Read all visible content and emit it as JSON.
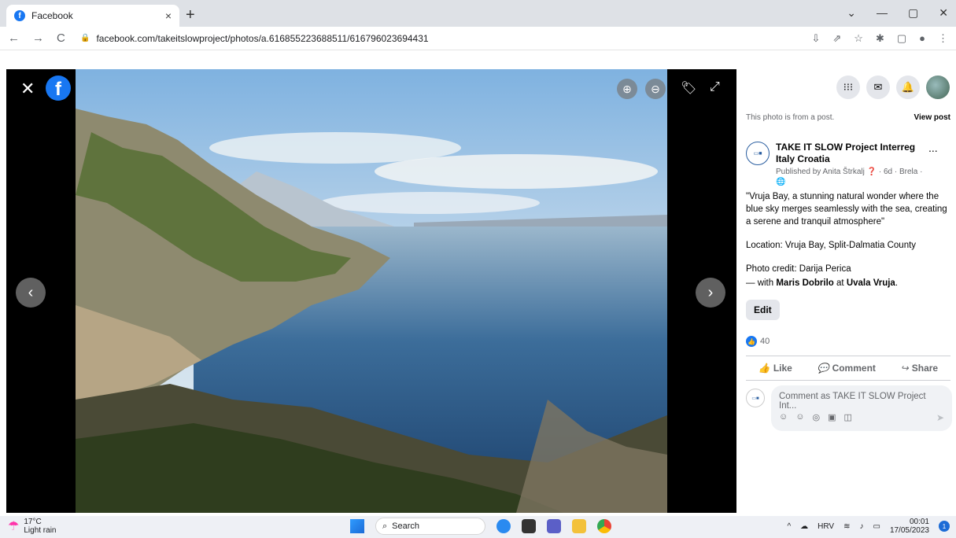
{
  "browser": {
    "tab_title": "Facebook",
    "tab_favicon": "f",
    "url": "facebook.com/takeitslowproject/photos/a.616855223688511/616796023694431",
    "new_tab": "+",
    "win_controls": [
      "⌄",
      "—",
      "▢",
      "✕"
    ]
  },
  "viewer": {
    "close": "✕",
    "logo": "f",
    "zoom_in": "⊕",
    "zoom_out": "⊖",
    "tag": "🏷",
    "fullscreen": "⤢",
    "prev": "‹",
    "next": "›"
  },
  "side": {
    "from_post": "This photo is from a post.",
    "view_post": "View post",
    "page_name": "TAKE IT SLOW Project Interreg Italy Croatia",
    "published": "Published by Anita Štrkalj ❓ · 6d · Brela ·",
    "globe": "🌐",
    "more": "...",
    "caption": "\"Vruja Bay, a stunning natural wonder where the blue sky merges seamlessly with the sea, creating a serene and tranquil atmosphere\"",
    "location": "Location: Vruja Bay, Split-Dalmatia County",
    "credit": "Photo credit: Darija Perica",
    "with_prefix": "— with ",
    "with_person": "Maris Dobrilo",
    "at": " at ",
    "place": "Uvala Vruja",
    "period": ".",
    "edit": "Edit",
    "like_count": "40",
    "like": "Like",
    "comment": "Comment",
    "share": "Share",
    "comment_placeholder": "Comment as TAKE IT SLOW Project Int..."
  },
  "taskbar": {
    "temp": "17°C",
    "weather": "Light rain",
    "search": "Search",
    "lang": "HRV",
    "time": "00:01",
    "date": "17/05/2023",
    "notif_count": "1"
  }
}
